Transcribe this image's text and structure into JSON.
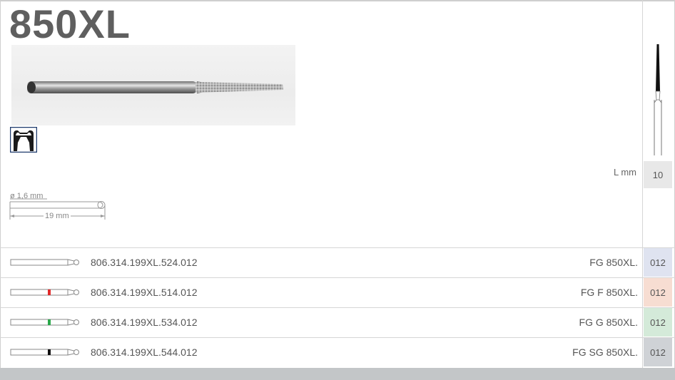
{
  "product": {
    "title": "850XL"
  },
  "icons": {
    "photo": "diamond-bur-photo",
    "tooth": "crown-tooth-icon",
    "bur": "bur-profile-icon"
  },
  "dimensions": {
    "diameter": "ø 1,6 mm",
    "length": "19 mm"
  },
  "length_row": {
    "label": "L mm",
    "value": "10"
  },
  "rows": [
    {
      "code": "806.314.199XL.524.012",
      "fg": "FG 850XL.",
      "pkg": "012",
      "band_color": "none",
      "pkg_bg": "#dfe3f0"
    },
    {
      "code": "806.314.199XL.514.012",
      "fg": "FG F 850XL.",
      "pkg": "012",
      "band_color": "#e02a2a",
      "pkg_bg": "#f7ddd2"
    },
    {
      "code": "806.314.199XL.534.012",
      "fg": "FG G 850XL.",
      "pkg": "012",
      "band_color": "#2aa84a",
      "pkg_bg": "#d4ead9"
    },
    {
      "code": "806.314.199XL.544.012",
      "fg": "FG SG 850XL.",
      "pkg": "012",
      "band_color": "#111111",
      "pkg_bg": "#cfd2d6"
    }
  ]
}
